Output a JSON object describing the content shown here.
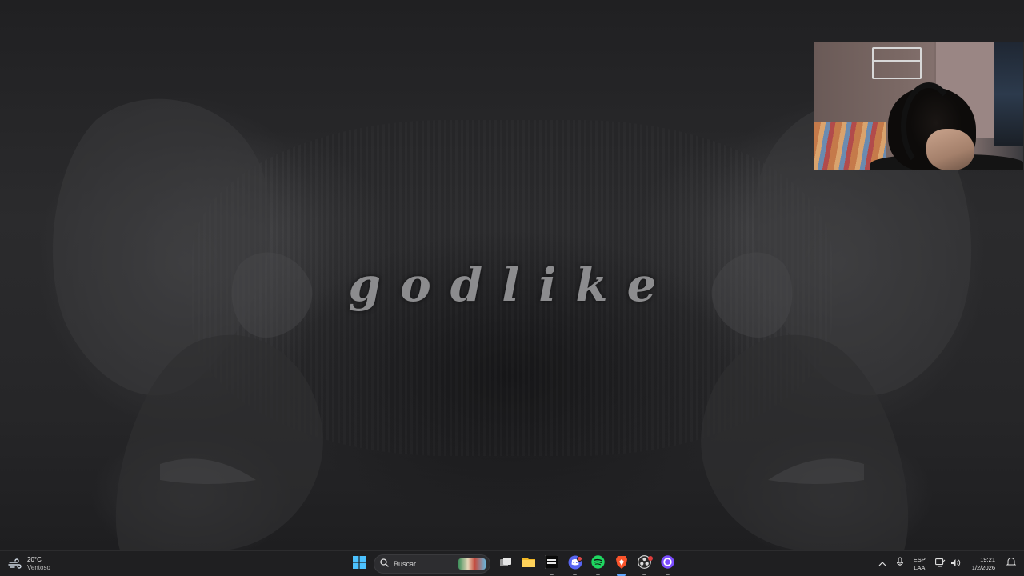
{
  "desktop": {
    "wallpaper_text": "godlike"
  },
  "taskbar": {
    "weather": {
      "temperature": "20°C",
      "condition": "Ventoso",
      "icon": "windy-weather-icon"
    },
    "start": {
      "icon": "windows-start-icon"
    },
    "search": {
      "placeholder": "Buscar"
    },
    "apps": [
      {
        "name": "task-view",
        "icon": "task-view-icon"
      },
      {
        "name": "file-explorer",
        "icon": "folder-icon"
      },
      {
        "name": "capcut",
        "icon": "capcut-icon"
      },
      {
        "name": "discord",
        "icon": "discord-icon",
        "badge": "1"
      },
      {
        "name": "spotify",
        "icon": "spotify-icon"
      },
      {
        "name": "brave",
        "icon": "brave-icon",
        "active": true
      },
      {
        "name": "obs",
        "icon": "obs-icon"
      },
      {
        "name": "app-circle",
        "icon": "circle-app-icon"
      }
    ],
    "tray": {
      "language_top": "ESP",
      "language_bottom": "LAA",
      "time": "19:21",
      "date": "1/2/2026"
    }
  },
  "colors": {
    "taskbar_bg": "#1f1f21",
    "accent_blue": "#60a8ff",
    "wallpaper_text": "#8c8c8e"
  }
}
